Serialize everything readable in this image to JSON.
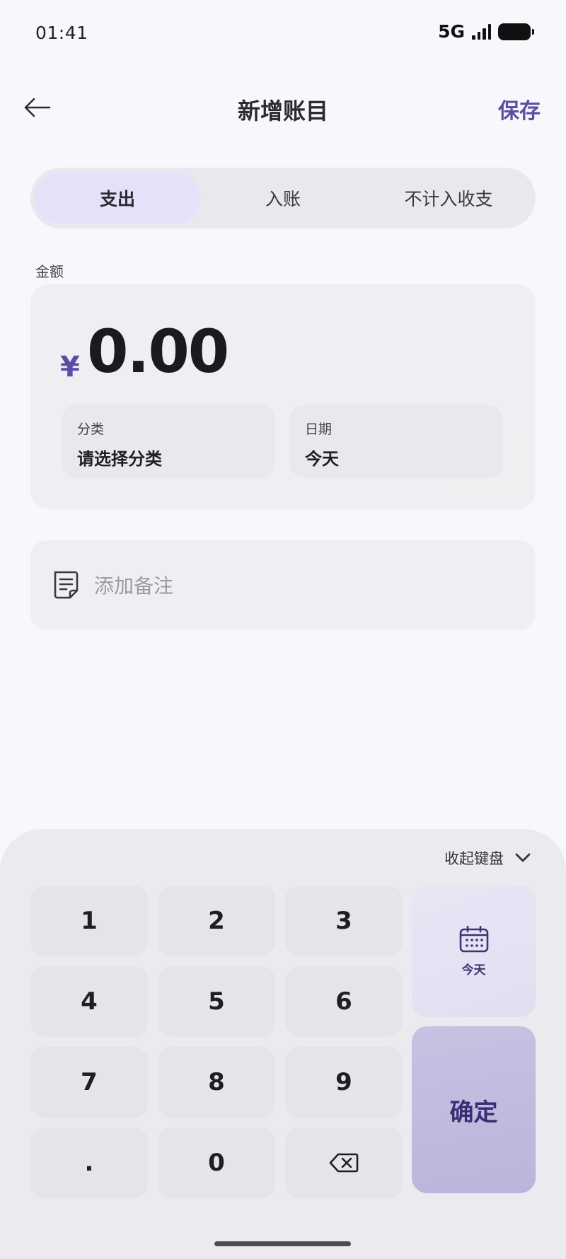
{
  "status_bar": {
    "time": "01:41",
    "network": "5G"
  },
  "header": {
    "title": "新增账目",
    "save_label": "保存"
  },
  "tabs": [
    {
      "label": "支出",
      "active": true
    },
    {
      "label": "入账",
      "active": false
    },
    {
      "label": "不计入收支",
      "active": false
    }
  ],
  "amount": {
    "label": "金额",
    "currency": "¥",
    "value": "0.00",
    "category": {
      "label": "分类",
      "value": "请选择分类"
    },
    "date": {
      "label": "日期",
      "value": "今天"
    }
  },
  "memo": {
    "placeholder": "添加备注"
  },
  "keyboard": {
    "collapse_label": "收起键盘",
    "keys": [
      "1",
      "2",
      "3",
      "4",
      "5",
      "6",
      "7",
      "8",
      "9",
      ".",
      "0"
    ],
    "today_label": "今天",
    "confirm_label": "确定"
  },
  "colors": {
    "accent": "#5c4fa2",
    "confirm_bg": "#c1bbe0",
    "today_bg": "#e6e3f3"
  }
}
